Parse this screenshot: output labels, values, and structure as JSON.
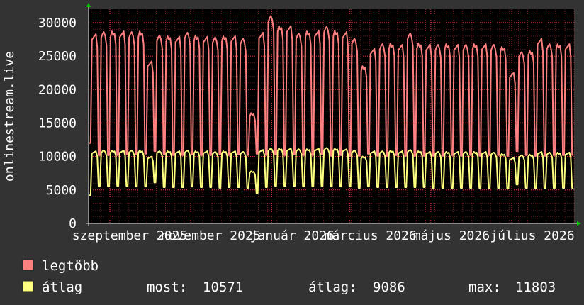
{
  "chart_data": {
    "type": "line",
    "ylabel": "onlinestream.live",
    "ylim": [
      0,
      32000
    ],
    "yticks": [
      0,
      5000,
      10000,
      15000,
      20000,
      25000,
      30000
    ],
    "xtick_labels": [
      "szeptember 2025",
      "november 2025",
      "január 2026",
      "március 2026",
      "május 2026",
      "július 2026"
    ],
    "x_start": "2025-08-16",
    "x_end": "2026-08-17",
    "grid": true,
    "legend_position": "bottom",
    "colors": {
      "background": "#333333",
      "plot_background": "#000000",
      "grid": "#ff4040",
      "axis": "#e0e0e0",
      "arrow": "#00cc00",
      "text": "#ffffff"
    },
    "series": [
      {
        "name": "legtöbb",
        "color": "#ff8080",
        "weekly_peaks": [
          30800,
          28300,
          28600,
          28700,
          28700,
          28600,
          28700,
          24200,
          28100,
          28000,
          27900,
          28500,
          28100,
          27900,
          27800,
          28000,
          28000,
          27600,
          16500,
          28500,
          31000,
          29500,
          29500,
          28400,
          28700,
          28800,
          29400,
          28800,
          28600,
          27600,
          23500,
          26100,
          26800,
          26900,
          26700,
          28400,
          26900,
          26700,
          26700,
          26800,
          26700,
          26700,
          26800,
          26800,
          26700,
          26400,
          22500,
          25600,
          25800,
          27600,
          26800
        ],
        "weekly_lows": [
          12000,
          10200,
          10200,
          10200,
          10300,
          10300,
          10400,
          10800,
          10300,
          10200,
          10200,
          10300,
          10200,
          10200,
          10300,
          10200,
          10300,
          10200,
          10400,
          10200,
          10300,
          10200,
          10300,
          10200,
          10200,
          10300,
          10100,
          10200,
          10100,
          10100,
          10400,
          10100,
          10100,
          10200,
          10100,
          10100,
          10100,
          10100,
          10100,
          10200,
          10100,
          10200,
          10100,
          10200,
          10200,
          10100,
          10800,
          10200,
          10100,
          10100,
          10200
        ]
      },
      {
        "name": "átlag",
        "color": "#ffff80",
        "weekly_peaks": [
          10900,
          10800,
          10900,
          10900,
          10900,
          10900,
          10900,
          10000,
          10800,
          10800,
          10800,
          10900,
          10800,
          10800,
          10700,
          10800,
          10800,
          10700,
          7800,
          11000,
          11200,
          11200,
          11200,
          11100,
          11100,
          11200,
          11300,
          11200,
          11100,
          10900,
          10000,
          10800,
          10800,
          10900,
          10800,
          11000,
          10800,
          10700,
          10700,
          10700,
          10700,
          10700,
          10700,
          10700,
          10600,
          10400,
          9800,
          10200,
          10300,
          10700,
          10600
        ],
        "weekly_lows": [
          4200,
          5500,
          5500,
          5600,
          5600,
          5500,
          5500,
          6100,
          5400,
          5400,
          5400,
          5500,
          5400,
          5400,
          5300,
          5400,
          5400,
          5300,
          4500,
          5400,
          5600,
          5600,
          5600,
          5500,
          5500,
          5600,
          5500,
          5500,
          5500,
          5300,
          5500,
          5400,
          5400,
          5400,
          5400,
          5400,
          5400,
          5300,
          5300,
          5300,
          5300,
          5300,
          5300,
          5300,
          5300,
          5200,
          5800,
          5300,
          5300,
          5300,
          5300
        ]
      }
    ]
  },
  "legend": {
    "series1_label": "legtöbb",
    "series2_label": "átlag",
    "stats": {
      "current_label": "most:",
      "current_value": "10571",
      "avg_label": "átlag:",
      "avg_value": "9086",
      "max_label": "max:",
      "max_value": "11803"
    }
  }
}
